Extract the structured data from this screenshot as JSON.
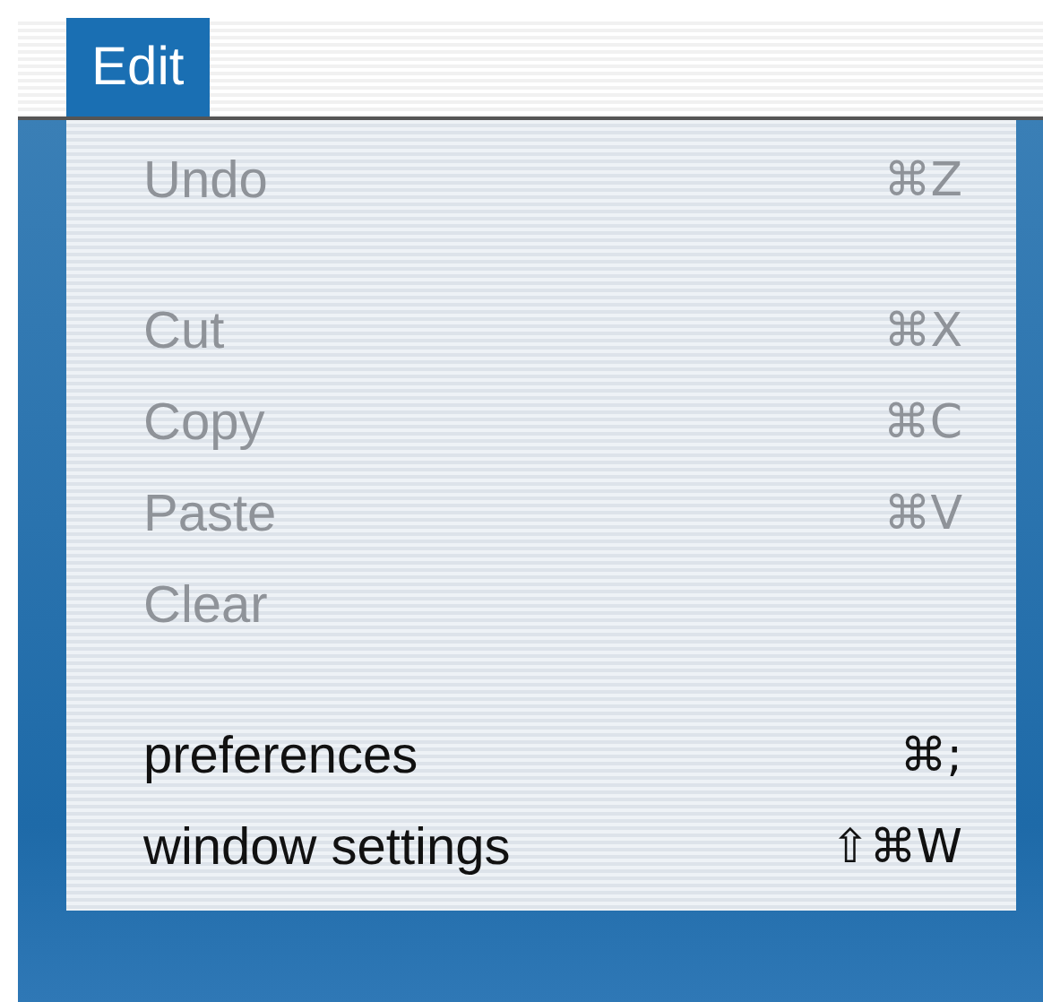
{
  "menubar": {
    "items": [
      {
        "label": "Edit",
        "selected": true
      }
    ]
  },
  "menu": {
    "items": [
      {
        "kind": "item",
        "label": "Undo",
        "shortcut": "⌘Z",
        "disabled": true
      },
      {
        "kind": "separator"
      },
      {
        "kind": "item",
        "label": "Cut",
        "shortcut": "⌘X",
        "disabled": true
      },
      {
        "kind": "item",
        "label": "Copy",
        "shortcut": "⌘C",
        "disabled": true
      },
      {
        "kind": "item",
        "label": "Paste",
        "shortcut": "⌘V",
        "disabled": true
      },
      {
        "kind": "item",
        "label": "Clear",
        "disabled": true
      },
      {
        "kind": "separator"
      },
      {
        "kind": "item",
        "label": "preferences",
        "shortcut": "⌘;",
        "disabled": false
      },
      {
        "kind": "item",
        "label": "window settings",
        "shortcut": "⇧⌘W",
        "disabled": false
      }
    ]
  }
}
